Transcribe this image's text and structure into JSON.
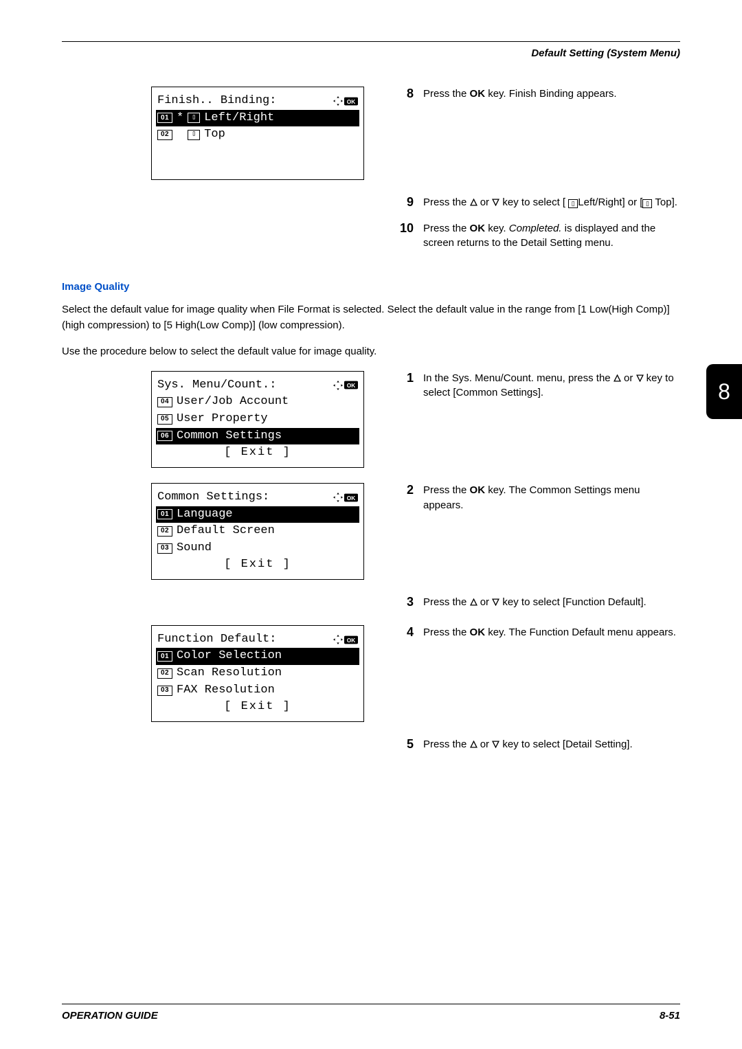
{
  "header": {
    "section_title": "Default Setting (System Menu)"
  },
  "lcd1": {
    "title": "Finish.. Binding:",
    "rows": [
      {
        "num": "01",
        "selected": true,
        "star": "*",
        "text": "Left/Right"
      },
      {
        "num": "02",
        "selected": false,
        "star": " ",
        "text": "Top"
      }
    ]
  },
  "steps_top": [
    {
      "n": "8",
      "html_prefix": "Press the ",
      "bold1": "OK",
      "html_suffix": " key. Finish Binding appears."
    },
    {
      "n": "9",
      "html": "Press the △ or ▽ key to select [ ⌶ Left/Right] or [ ⌶ Top]."
    },
    {
      "n": "10",
      "html_prefix": "Press the ",
      "bold1": "OK",
      "mid": " key. ",
      "ital": "Completed.",
      "html_suffix": " is displayed and the screen returns to the Detail Setting menu."
    }
  ],
  "section": {
    "title": "Image Quality",
    "para1": "Select the default value for image quality when File Format is selected. Select the default value in the range from [1 Low(High Comp)] (high compression) to [5 High(Low Comp)] (low compression).",
    "para2": "Use the procedure below to select the default value for image quality."
  },
  "lcd2": {
    "title": "Sys. Menu/Count.:",
    "rows": [
      {
        "num": "04",
        "selected": false,
        "text": "User/Job Account"
      },
      {
        "num": "05",
        "selected": false,
        "text": "User Property"
      },
      {
        "num": "06",
        "selected": true,
        "text": "Common Settings"
      }
    ],
    "exit": "[  Exit   ]"
  },
  "lcd3": {
    "title": "Common Settings:",
    "rows": [
      {
        "num": "01",
        "selected": true,
        "text": "Language"
      },
      {
        "num": "02",
        "selected": false,
        "text": "Default Screen"
      },
      {
        "num": "03",
        "selected": false,
        "text": "Sound"
      }
    ],
    "exit": "[  Exit   ]"
  },
  "lcd4": {
    "title": "Function Default:",
    "rows": [
      {
        "num": "01",
        "selected": true,
        "text": "Color Selection"
      },
      {
        "num": "02",
        "selected": false,
        "text": "Scan Resolution"
      },
      {
        "num": "03",
        "selected": false,
        "text": "FAX Resolution"
      }
    ],
    "exit": "[  Exit   ]"
  },
  "steps_proc": [
    {
      "n": "1",
      "text": "In the Sys. Menu/Count. menu, press the △ or ▽ key to select [Common Settings]."
    },
    {
      "n": "2",
      "prefix": "Press the ",
      "bold": "OK",
      "suffix": " key. The Common Settings menu appears."
    },
    {
      "n": "3",
      "text": "Press the △ or ▽ key to select [Function Default]."
    },
    {
      "n": "4",
      "prefix": "Press the ",
      "bold": "OK",
      "suffix": " key. The Function Default menu appears."
    },
    {
      "n": "5",
      "text": "Press the △ or ▽ key to select [Detail Setting]."
    }
  ],
  "side_tab": "8",
  "footer": {
    "left": "OPERATION GUIDE",
    "right": "8-51"
  }
}
